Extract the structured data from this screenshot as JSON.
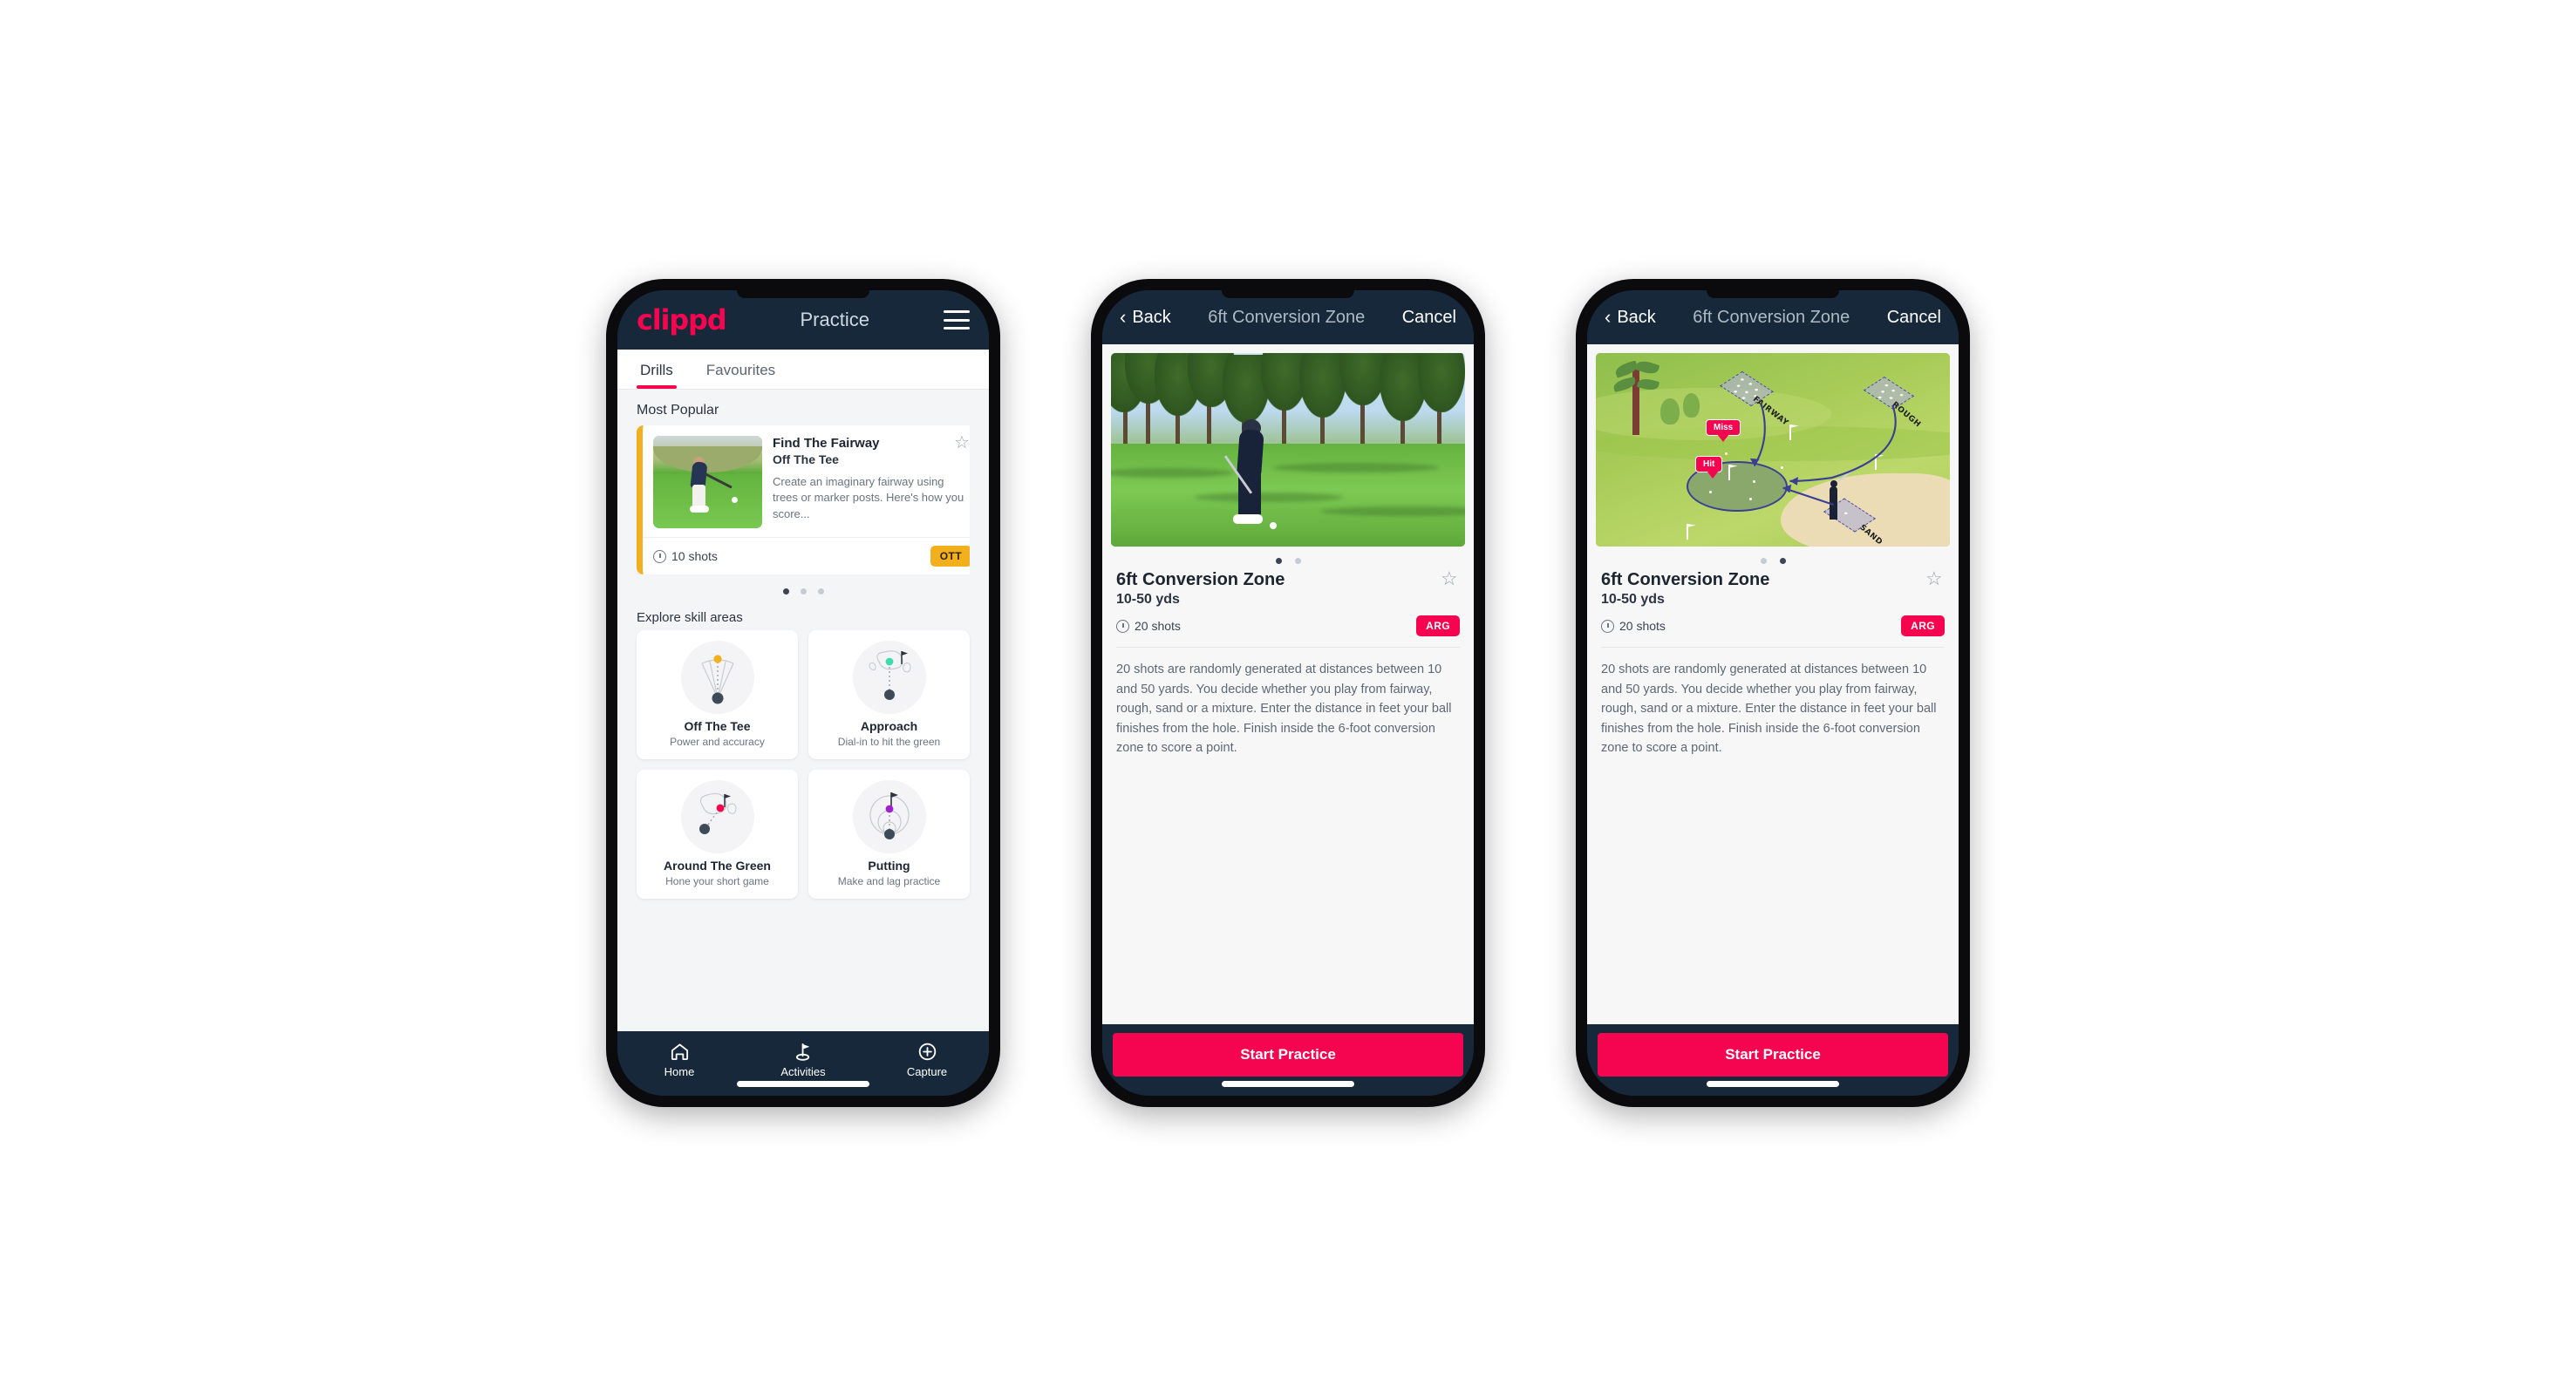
{
  "phone1": {
    "navbar": {
      "logo": "clippd",
      "title": "Practice",
      "menu_icon": "hamburger-icon"
    },
    "tabs": [
      {
        "label": "Drills",
        "active": true
      },
      {
        "label": "Favourites",
        "active": false
      }
    ],
    "most_popular": {
      "section_title": "Most Popular",
      "card": {
        "name": "Find The Fairway",
        "category": "Off The Tee",
        "description": "Create an imaginary fairway using trees or marker posts. Here's how you score...",
        "shots": "10 shots",
        "badge": "OTT",
        "badge_color": "#F2B01E",
        "accent_color": "#F2B01E",
        "star_icon": "star-outline-icon",
        "clock_icon": "clock-icon"
      },
      "next_card_accent": "#3EDBB0",
      "dots": [
        true,
        false,
        false
      ]
    },
    "skills": {
      "section_title": "Explore skill areas",
      "items": [
        {
          "name": "Off The Tee",
          "sub": "Power and accuracy",
          "icon": "tee-fan-icon",
          "dot_color": "#F2B01E"
        },
        {
          "name": "Approach",
          "sub": "Dial-in to hit the green",
          "icon": "approach-green-icon",
          "dot_color": "#3EDBB0"
        },
        {
          "name": "Around The Green",
          "sub": "Hone your short game",
          "icon": "around-green-icon",
          "dot_color": "#F5054F"
        },
        {
          "name": "Putting",
          "sub": "Make and lag practice",
          "icon": "putting-rings-icon",
          "dot_color": "#A020D0"
        }
      ]
    },
    "tabbar": [
      {
        "label": "Home",
        "icon": "home-icon",
        "active": false
      },
      {
        "label": "Activities",
        "icon": "golf-flag-icon",
        "active": true
      },
      {
        "label": "Capture",
        "icon": "plus-circle-icon",
        "active": false
      }
    ]
  },
  "phone2": {
    "navbar": {
      "back": "Back",
      "title": "6ft Conversion Zone",
      "cancel": "Cancel",
      "back_icon": "chevron-left-icon"
    },
    "media": {
      "type": "photo",
      "alt": "golfer-pitching-photo"
    },
    "dots": [
      true,
      false
    ],
    "detail": {
      "title": "6ft Conversion Zone",
      "subtitle": "10-50 yds",
      "shots": "20 shots",
      "badge": "ARG",
      "badge_color": "#F5054F",
      "star_icon": "star-outline-icon",
      "clock_icon": "clock-icon",
      "description": "20 shots are randomly generated at distances between 10 and 50 yards. You decide whether you play from fairway, rough, sand or a mixture. Enter the distance in feet your ball finishes from the hole. Finish inside the 6-foot conversion zone to score a point."
    },
    "cta": "Start Practice"
  },
  "phone3": {
    "navbar": {
      "back": "Back",
      "title": "6ft Conversion Zone",
      "cancel": "Cancel",
      "back_icon": "chevron-left-icon"
    },
    "media": {
      "type": "illustration",
      "alt": "golf-course-diagram",
      "zone_labels": [
        "FAIRWAY",
        "ROUGH",
        "SAND"
      ],
      "callouts": [
        "Miss",
        "Hit"
      ],
      "callout_color": "#F5054F"
    },
    "dots": [
      false,
      true
    ],
    "detail": {
      "title": "6ft Conversion Zone",
      "subtitle": "10-50 yds",
      "shots": "20 shots",
      "badge": "ARG",
      "badge_color": "#F5054F",
      "star_icon": "star-outline-icon",
      "clock_icon": "clock-icon",
      "description": "20 shots are randomly generated at distances between 10 and 50 yards. You decide whether you play from fairway, rough, sand or a mixture. Enter the distance in feet your ball finishes from the hole. Finish inside the 6-foot conversion zone to score a point."
    },
    "cta": "Start Practice"
  }
}
